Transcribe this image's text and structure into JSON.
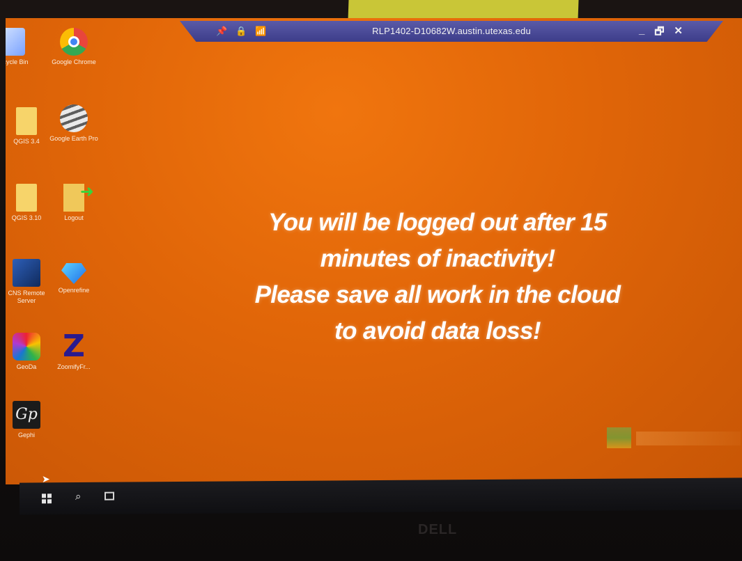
{
  "remote_session": {
    "hostname": "RLP1402-D10682W.austin.utexas.edu",
    "controls": {
      "pin_icon": "pin-icon",
      "lock_icon": "lock-icon",
      "signal_icon": "signal-icon",
      "minimize": "_",
      "restore": "🗗",
      "close": "✕"
    }
  },
  "desktop": {
    "background_color": "#e06508",
    "icons": [
      {
        "label": "ecycle Bin"
      },
      {
        "label": "Google Chrome"
      },
      {
        "label": "QGIS 3.4"
      },
      {
        "label": "Google Earth Pro"
      },
      {
        "label": "QGIS 3.10"
      },
      {
        "label": "Logout"
      },
      {
        "label": "CNS Remote Server"
      },
      {
        "label": "Openrefine"
      },
      {
        "label": "GeoDa"
      },
      {
        "label": "ZoomifyFr..."
      },
      {
        "label": "Gephi"
      }
    ],
    "message": {
      "line1": "You will be logged out after 15",
      "line2": "minutes of inactivity!",
      "line3": "Please save all work in the cloud",
      "line4": "to avoid data loss!"
    }
  },
  "monitor": {
    "brand": "DELL"
  }
}
